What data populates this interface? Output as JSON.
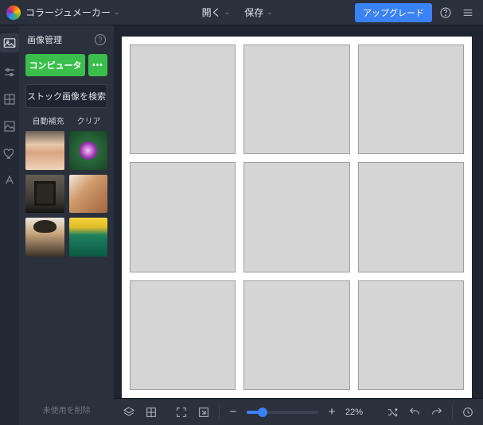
{
  "header": {
    "app_title": "コラージュメーカー",
    "open_label": "開く",
    "save_label": "保存",
    "upgrade_label": "アップグレード"
  },
  "panel": {
    "title": "画像管理",
    "computer_button": "コンピュータ",
    "more_button": "•••",
    "stock_search_button": "ストック画像を検索",
    "auto_fill": "自動補充",
    "clear": "クリア",
    "delete_unused": "未使用を削除"
  },
  "thumbnails": [
    {
      "name": "portrait-woman-blonde"
    },
    {
      "name": "purple-flower"
    },
    {
      "name": "vintage-camera"
    },
    {
      "name": "portrait-woman-smiling"
    },
    {
      "name": "portrait-woman-hat"
    },
    {
      "name": "vintage-truck-sunflowers"
    }
  ],
  "zoom": {
    "percent_label": "22%"
  },
  "rail_items": [
    "image",
    "adjust",
    "layout",
    "background",
    "heart",
    "text"
  ]
}
